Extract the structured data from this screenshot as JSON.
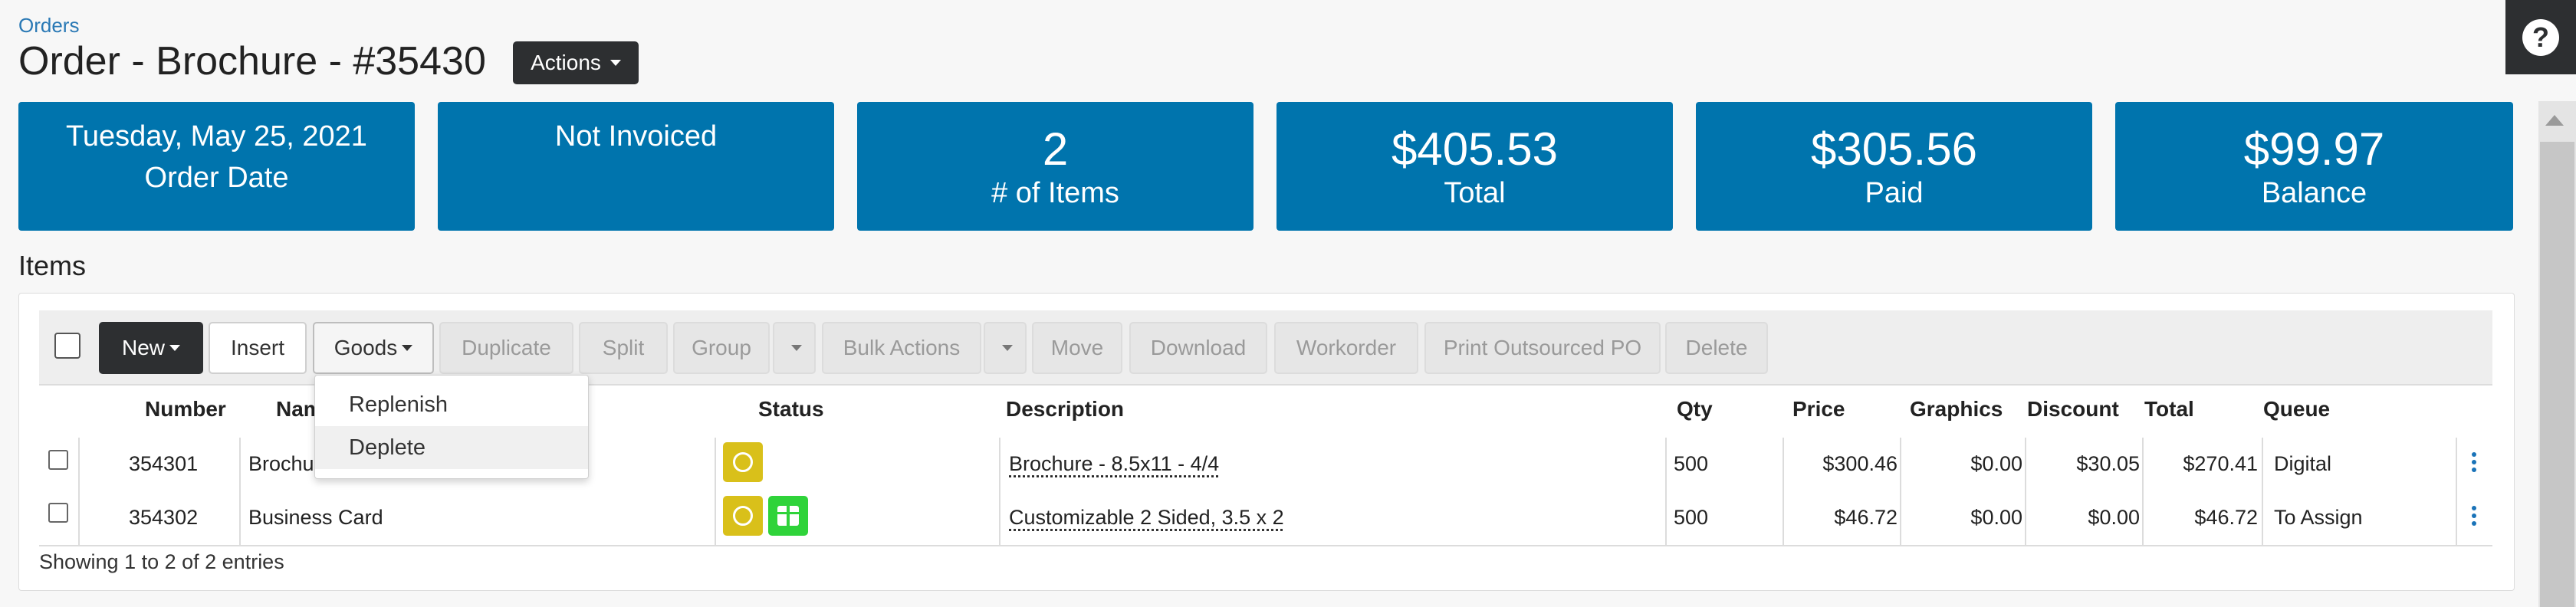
{
  "breadcrumb": "Orders",
  "title": "Order - Brochure - #35430",
  "actions_label": "Actions",
  "help_icon": "?",
  "cards": {
    "order_date": {
      "value": "Tuesday, May 25, 2021",
      "label": "Order Date"
    },
    "invoice": {
      "value": "Not Invoiced"
    },
    "items": {
      "value": "2",
      "label": "# of Items"
    },
    "total": {
      "value": "$405.53",
      "label": "Total"
    },
    "paid": {
      "value": "$305.56",
      "label": "Paid"
    },
    "balance": {
      "value": "$99.97",
      "label": "Balance"
    }
  },
  "items_heading": "Items",
  "toolbar": {
    "new": "New",
    "insert": "Insert",
    "goods": "Goods",
    "duplicate": "Duplicate",
    "split": "Split",
    "group": "Group",
    "bulk_actions": "Bulk Actions",
    "move": "Move",
    "download": "Download",
    "workorder": "Workorder",
    "print_outsourced_po": "Print Outsourced PO",
    "delete": "Delete"
  },
  "goods_menu": [
    "Replenish",
    "Deplete"
  ],
  "columns": {
    "number": "Number",
    "name": "Name",
    "status": "Status",
    "description": "Description",
    "qty": "Qty",
    "price": "Price",
    "graphics": "Graphics",
    "discount": "Discount",
    "total": "Total",
    "queue": "Queue"
  },
  "rows": [
    {
      "number": "354301",
      "name": "Brochure",
      "description": "Brochure - 8.5x11 - 4/4",
      "qty": "500",
      "price": "$300.46",
      "graphics": "$0.00",
      "discount": "$30.05",
      "total": "$270.41",
      "queue": "Digital"
    },
    {
      "number": "354302",
      "name": "Business Card",
      "description": "Customizable 2 Sided, 3.5 x 2",
      "qty": "500",
      "price": "$46.72",
      "graphics": "$0.00",
      "discount": "$0.00",
      "total": "$46.72",
      "queue": "To Assign"
    }
  ],
  "footer": "Showing 1 to 2 of 2 entries",
  "colors": {
    "card_blue": "#0074ad",
    "dark_button": "#2d2f31",
    "status_yellow": "#d9c01a",
    "status_green": "#2fd33a",
    "link_blue": "#2a79b5"
  }
}
